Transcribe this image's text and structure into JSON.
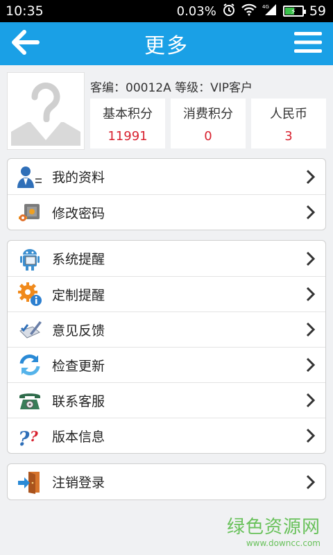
{
  "status_bar": {
    "time": "10:35",
    "speed": "0.03%",
    "network": "4G",
    "battery_level": 59,
    "battery_text": "59"
  },
  "header": {
    "title": "更多",
    "back_icon": "arrow-left-icon",
    "menu_icon": "hamburger-menu-icon",
    "color": "#1aa0e6"
  },
  "profile": {
    "info": "客编：00012A  等级：VIP客户",
    "stats": [
      {
        "label": "基本积分",
        "value": "11991"
      },
      {
        "label": "消费积分",
        "value": "0"
      },
      {
        "label": "人民币",
        "value": "3"
      }
    ],
    "value_color": "#d8212f"
  },
  "menu_groups": [
    {
      "items": [
        {
          "label": "我的资料",
          "icon": "user-card-icon"
        },
        {
          "label": "修改密码",
          "icon": "key-lock-icon"
        }
      ]
    },
    {
      "items": [
        {
          "label": "系统提醒",
          "icon": "robot-notice-icon"
        },
        {
          "label": "定制提醒",
          "icon": "gear-info-icon"
        },
        {
          "label": "意见反馈",
          "icon": "feedback-pen-icon"
        },
        {
          "label": "检查更新",
          "icon": "refresh-icon"
        },
        {
          "label": "联系客服",
          "icon": "telephone-icon"
        },
        {
          "label": "版本信息",
          "icon": "question-icon"
        }
      ]
    },
    {
      "items": [
        {
          "label": "注销登录",
          "icon": "logout-door-icon"
        }
      ]
    }
  ],
  "watermark": {
    "main": "绿色资源网",
    "sub": "www.downcc.com"
  }
}
